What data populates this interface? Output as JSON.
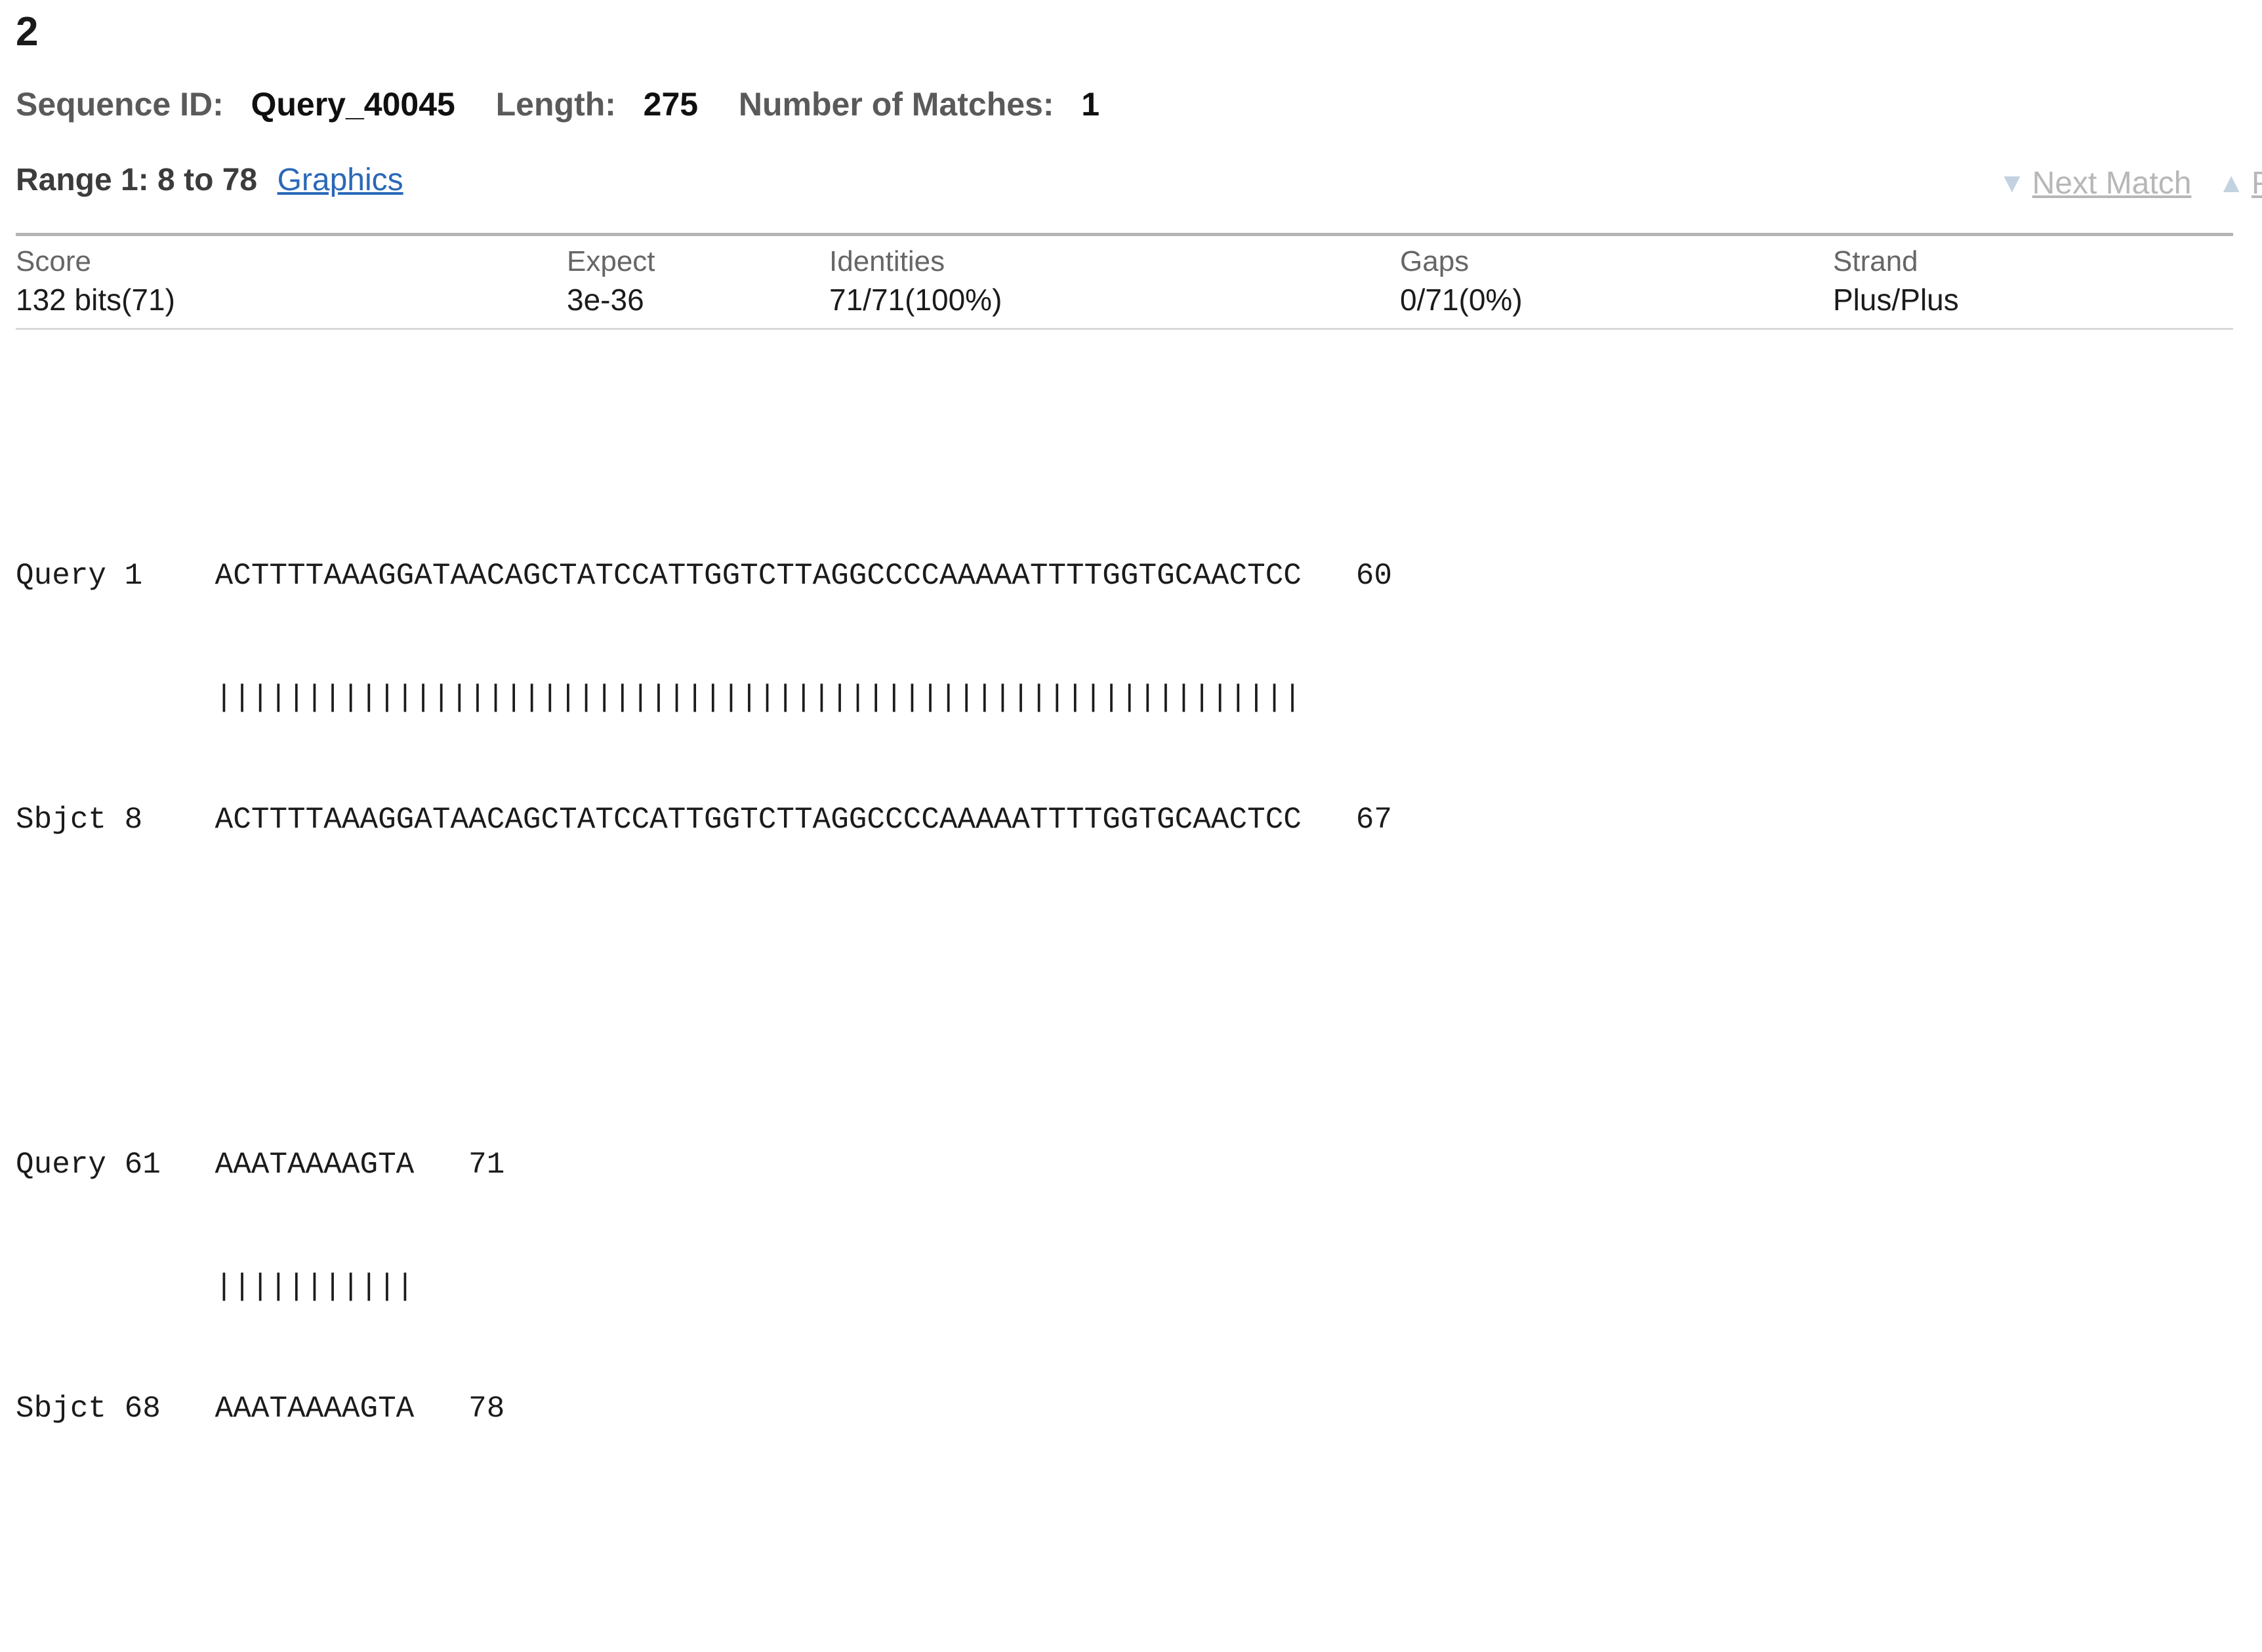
{
  "hit": {
    "number": "2",
    "sequence_id_label": "Sequence ID:",
    "sequence_id_value": "Query_40045",
    "length_label": "Length:",
    "length_value": "275",
    "matches_label": "Number of Matches:",
    "matches_value": "1"
  },
  "range": {
    "title": "Range 1: 8 to 78",
    "graphics_link": "Graphics",
    "next_match_label": "Next Match",
    "prev_match_label": "P",
    "down_arrow": "▼",
    "up_arrow": "▲"
  },
  "stats": {
    "headers": [
      "Score",
      "Expect",
      "Identities",
      "Gaps",
      "Strand"
    ],
    "values": [
      "132 bits(71)",
      "3e-36",
      "71/71(100%)",
      "0/71(0%)",
      "Plus/Plus"
    ]
  },
  "alignment": {
    "query_label": "Query",
    "subject_label": "Sbjct",
    "blocks": [
      {
        "query_start": "1",
        "query_seq": "ACTTTTAAAGGATAACAGCTATCCATTGGTCTTAGGCCCCAAAAATTTTGGTGCAACTCC",
        "query_end": "60",
        "midline": "||||||||||||||||||||||||||||||||||||||||||||||||||||||||||||",
        "subject_start": "8",
        "subject_seq": "ACTTTTAAAGGATAACAGCTATCCATTGGTCTTAGGCCCCAAAAATTTTGGTGCAACTCC",
        "subject_end": "67"
      },
      {
        "query_start": "61",
        "query_seq": "AAATAAAAGTA",
        "query_end": "71",
        "midline": "|||||||||||",
        "subject_start": "68",
        "subject_seq": "AAATAAAAGTA",
        "subject_end": "78"
      }
    ]
  },
  "colors": {
    "link": "#2a68b8",
    "disabled_link": "#b7b7b7",
    "header_text": "#666666",
    "body_text": "#1b1b1b"
  }
}
